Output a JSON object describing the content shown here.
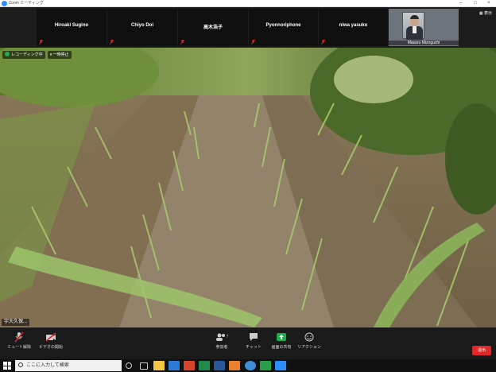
{
  "window": {
    "title": "Zoom ミーティング",
    "minimize": "–",
    "maximize": "□",
    "close": "×"
  },
  "participants": [
    {
      "name": "Hiroaki Sugino"
    },
    {
      "name": "Chiyo Doi"
    },
    {
      "name": "高木浩子"
    },
    {
      "name": "Pyonnoriphone"
    },
    {
      "name": "niwa yasuko"
    }
  ],
  "video_participant": {
    "name": "Masaru Mizoguchi"
  },
  "view_button": {
    "label": "表示"
  },
  "recording": {
    "status": "レコーディング中",
    "pause": "一時停止"
  },
  "active_speaker": {
    "name": "宇大久保..."
  },
  "controls": {
    "mute": "ミュート解除",
    "video": "ビデオの開始",
    "participants": "参加者",
    "participants_count": "7",
    "chat": "チャット",
    "share": "画面の共有",
    "reactions": "リアクション",
    "leave": "退出"
  },
  "taskbar": {
    "search_placeholder": "ここに入力して検索"
  },
  "colors": {
    "leave": "#e02828",
    "share": "#1fae4b",
    "muted": "#e02828"
  }
}
